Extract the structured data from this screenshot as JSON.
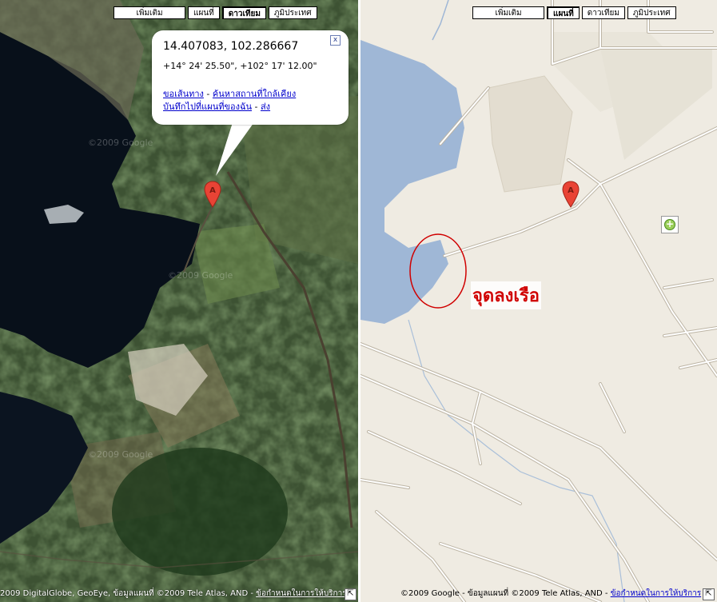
{
  "left_map": {
    "maptype_buttons": {
      "more": "เพิ่มเติม",
      "map": "แผนที่",
      "satellite": "ดาวเทียม",
      "terrain": "ภูมิประเทศ"
    },
    "active_type": "satellite",
    "watermark": "©2009 Google",
    "marker_label": "A",
    "info_window": {
      "coords": "14.407083, 102.286667",
      "dms": "+14° 24' 25.50\", +102° 17' 12.00\"",
      "link_directions": "ขอเส้นทาง",
      "link_nearby": "ค้นหาสถานที่ใกล้เคียง",
      "link_save": "บันทึกไปที่แผนที่ของฉัน",
      "link_send": "ส่ง",
      "separator": " - ",
      "close": "x"
    },
    "attribution": "2009 DigitalGlobe, GeoEye, ข้อมูลแผนที่ ©2009 Tele Atlas, AND - ",
    "terms_link": "ข้อกำหนดในการให้บริการ"
  },
  "right_map": {
    "maptype_buttons": {
      "more": "เพิ่มเติม",
      "map": "แผนที่",
      "satellite": "ดาวเทียม",
      "terrain": "ภูมิประเทศ"
    },
    "active_type": "map",
    "marker_label": "A",
    "annotation": "จุดลงเรือ",
    "attribution": "©2009 Google - ข้อมูลแผนที่ ©2009 Tele Atlas, AND - ",
    "terms_link": "ข้อกำหนดในการให้บริการ"
  },
  "colors": {
    "water": "#9fb7d6",
    "land": "#efebe2",
    "road": "#ffffff",
    "annotation": "#d00000",
    "marker": "#e94335"
  }
}
